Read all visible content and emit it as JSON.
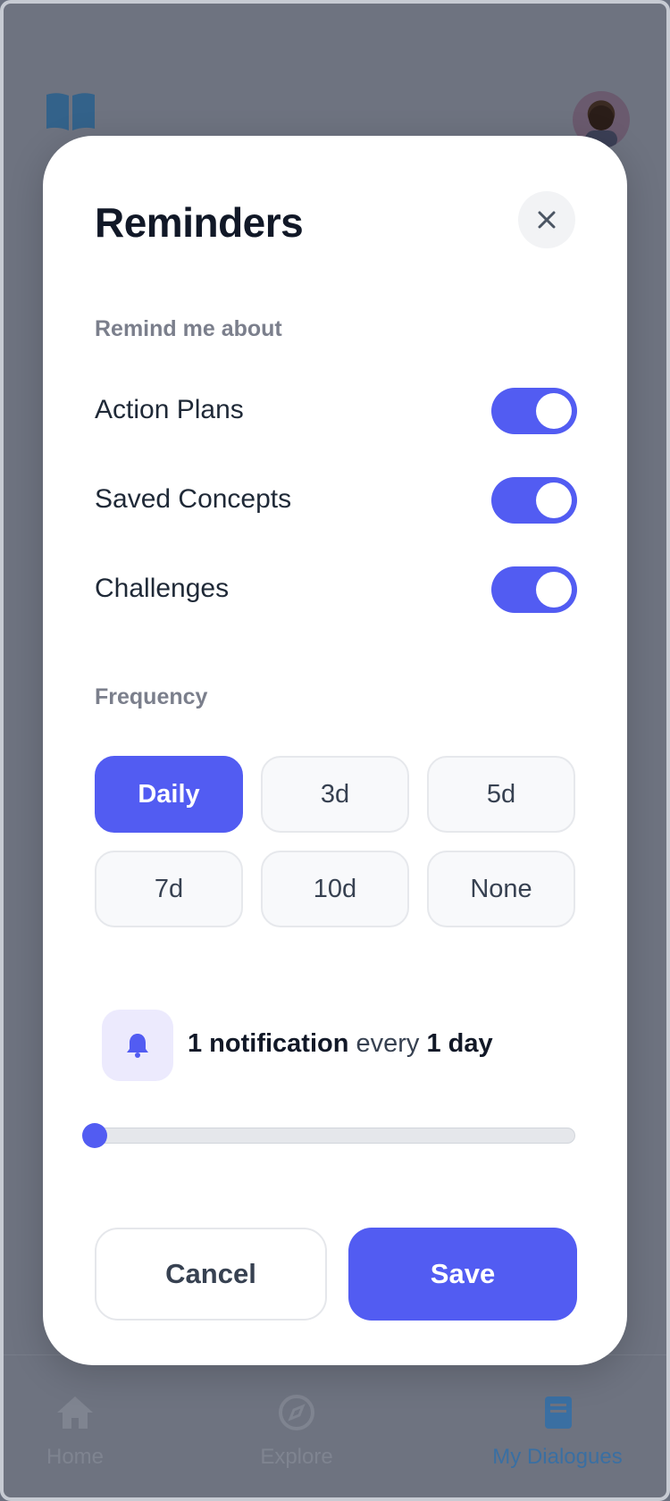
{
  "background": {
    "tabs": [
      {
        "label": "Home",
        "icon": "home-icon",
        "active": false
      },
      {
        "label": "Explore",
        "icon": "compass-icon",
        "active": false
      },
      {
        "label": "My Dialogues",
        "icon": "book-icon",
        "active": true
      }
    ]
  },
  "modal": {
    "title": "Reminders",
    "remind_label": "Remind me about",
    "toggles": [
      {
        "label": "Action Plans",
        "on": true
      },
      {
        "label": "Saved Concepts",
        "on": true
      },
      {
        "label": "Challenges",
        "on": true
      }
    ],
    "frequency_label": "Frequency",
    "frequency_options": [
      "Daily",
      "3d",
      "5d",
      "7d",
      "10d",
      "None"
    ],
    "frequency_selected": "Daily",
    "notification": {
      "count_text": "1 notification",
      "middle_text": "every",
      "interval_text": "1 day"
    },
    "slider_value": 0,
    "cancel_label": "Cancel",
    "save_label": "Save"
  },
  "colors": {
    "accent": "#525cf2",
    "overlay": "#6e7380"
  }
}
